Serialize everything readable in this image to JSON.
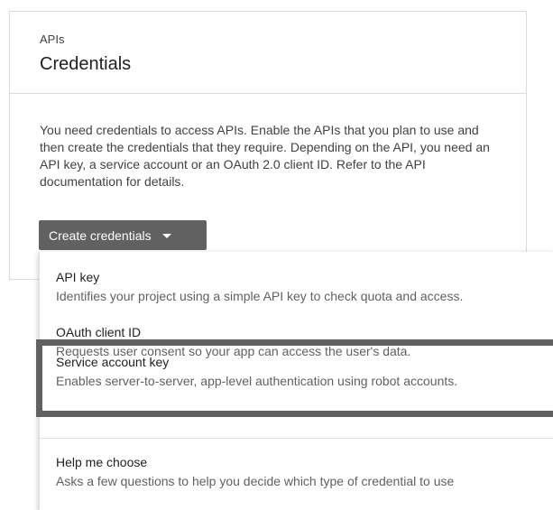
{
  "header": {
    "subtitle": "APIs",
    "title": "Credentials"
  },
  "description": "You need credentials to access APIs. Enable the APIs that you plan to use and then create the credentials that they require. Depending on the API, you need an API key, a service account or an OAuth 2.0 client ID. Refer to the API documentation for details.",
  "create_button": {
    "label": "Create credentials",
    "icon": "caret-down-icon"
  },
  "menu": {
    "items": [
      {
        "label": "API key",
        "description": "Identifies your project using a simple API key to check quota and access."
      },
      {
        "label": "OAuth client ID",
        "description": "Requests user consent so your app can access the user's data."
      },
      {
        "label": "Service account key",
        "description": "Enables server-to-server, app-level authentication using robot accounts."
      },
      {
        "label": "Help me choose",
        "description": "Asks a few questions to help you decide which type of credential to use"
      }
    ]
  },
  "colors": {
    "button_bg": "#616161",
    "highlight_border": "#616161",
    "divider": "#dadce0"
  }
}
